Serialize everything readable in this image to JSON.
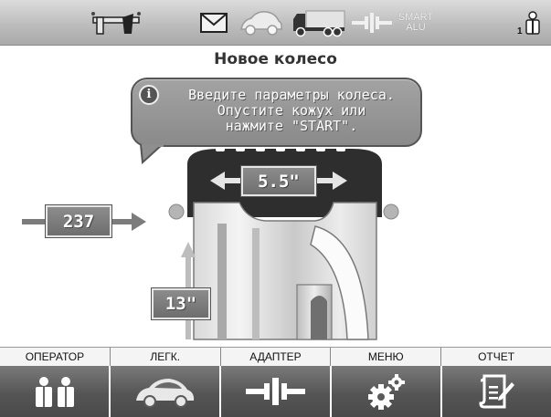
{
  "topbar": {
    "icons": [
      "wheel-balancer-icon",
      "envelope-icon",
      "car-icon",
      "truck-icon",
      "smart-alu-icon",
      "operator-icon"
    ],
    "smart_alu_label": "SMART\nALU",
    "operator_number": "1"
  },
  "main": {
    "title": "Новое колесо",
    "message": "Введите параметры колеса.\nОпустите кожух или\nнажмите \"START\".",
    "wheel": {
      "width": "5.5\"",
      "offset": "237",
      "diameter": "13\""
    }
  },
  "bottom": {
    "labels": [
      "ОПЕРАТОР",
      "ЛЕГК.",
      "АДАПТЕР",
      "МЕНЮ",
      "ОТЧЕТ"
    ],
    "icons": [
      "operators-icon",
      "car-icon",
      "adapter-icon",
      "gears-icon",
      "report-icon"
    ]
  },
  "colors": {
    "topbar": "#bdbdbd",
    "bubble": "#8f8f8f",
    "button": "#5a5a5a",
    "tire": "#2b2b2b"
  }
}
